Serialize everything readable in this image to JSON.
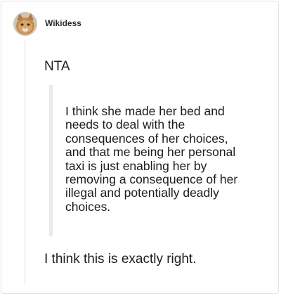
{
  "post": {
    "username": "Wikidess",
    "avatar_icon": "cat-avatar-icon",
    "verdict": "NTA",
    "quote": "I think she made her bed and needs to deal with the consequences of her choices, and that me being her personal taxi is just enabling her by removing a consequence of her illegal and potentially deadly choices.",
    "reply": "I think this is exactly right."
  },
  "colors": {
    "border": "#e3e3e3",
    "quote_bar": "#ebebeb",
    "text": "#1c1c1c"
  }
}
